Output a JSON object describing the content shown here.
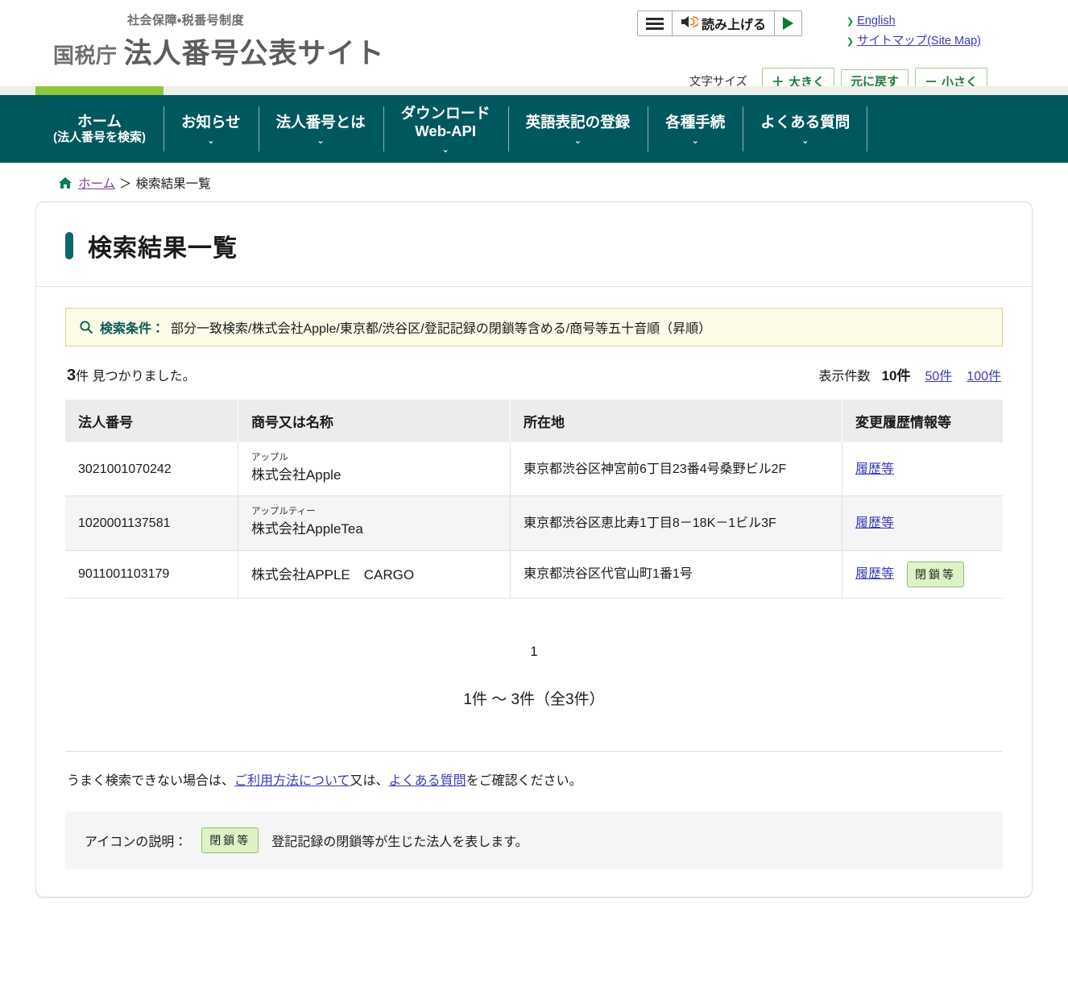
{
  "header": {
    "logo_sub": "社会保障・税番号制度",
    "logo_agency": "国税庁",
    "logo_title": "法人番号公表サイト",
    "speech": {
      "menu_icon": "hamburger-icon",
      "speaker_icon": "speaker-icon",
      "label": "読み上げる",
      "play_icon": "play-icon"
    },
    "corner_links": [
      {
        "label": "English"
      },
      {
        "label": "サイトマップ(Site Map)"
      }
    ],
    "fontsize": {
      "label": "文字サイズ",
      "bigger_sign": "＋",
      "bigger": "大きく",
      "reset": "元に戻す",
      "smaller_sign": "－",
      "smaller": "小さく"
    }
  },
  "nav": {
    "items": [
      {
        "label": "ホーム",
        "sub": "(法人番号を検索)",
        "caret": false,
        "active": true
      },
      {
        "label": "お知らせ",
        "sub": "",
        "caret": true,
        "active": false
      },
      {
        "label": "法人番号とは",
        "sub": "",
        "caret": true,
        "active": false
      },
      {
        "label": "ダウンロード",
        "sub": "Web-API",
        "caret": true,
        "active": false
      },
      {
        "label": "英語表記の登録",
        "sub": "",
        "caret": true,
        "active": false
      },
      {
        "label": "各種手続",
        "sub": "",
        "caret": true,
        "active": false
      },
      {
        "label": "よくある質問",
        "sub": "",
        "caret": true,
        "active": false
      }
    ]
  },
  "breadcrumb": {
    "home_icon": "home-icon",
    "home": "ホーム",
    "separator": "＞",
    "current": "検索結果一覧"
  },
  "page": {
    "title": "検索結果一覧"
  },
  "search_condition": {
    "icon": "search-icon",
    "label": "検索条件：",
    "value": "部分一致検索/株式会社Apple/東京都/渋谷区/登記記録の閉鎖等含める/商号等五十音順（昇順）"
  },
  "result_summary": {
    "count": "3",
    "count_suffix": "件 見つかりました。",
    "display_label": "表示件数",
    "current": "10件",
    "options": [
      "50件",
      "100件"
    ]
  },
  "table": {
    "columns": [
      "法人番号",
      "商号又は名称",
      "所在地",
      "変更履歴情報等"
    ],
    "rows": [
      {
        "number": "3021001070242",
        "kana": "アップル",
        "name": "株式会社Apple",
        "address": "東京都渋谷区神宮前6丁目23番4号桑野ビル2F",
        "history_link": "履歴等",
        "closed_badge": ""
      },
      {
        "number": "1020001137581",
        "kana": "アップルティー",
        "name": "株式会社AppleTea",
        "address": "東京都渋谷区恵比寿1丁目8－18K－1ビル3F",
        "history_link": "履歴等",
        "closed_badge": ""
      },
      {
        "number": "9011001103179",
        "kana": "",
        "name": "株式会社APPLE　CARGO",
        "address": "東京都渋谷区代官山町1番1号",
        "history_link": "履歴等",
        "closed_badge": "閉鎖等"
      }
    ]
  },
  "pagination": {
    "current_page": "1",
    "range_text": "1件 〜 3件（全3件）"
  },
  "help": {
    "prefix": "うまく検索できない場合は、",
    "link1": "ご利用方法について",
    "middle": "又は、",
    "link2": "よくある質問",
    "suffix": "をご確認ください。"
  },
  "icon_note": {
    "label": "アイコンの説明：",
    "badge": "閉鎖等",
    "description": "登記記録の閉鎖等が生じた法人を表します。"
  },
  "colors": {
    "nav_bg": "#00585f",
    "active_tab": "#8cc63e",
    "accent": "#046a68",
    "link": "#3b3bbd",
    "visited_link": "#7a3fa0",
    "condition_bg": "#fbfbe8",
    "badge_bg": "#ddf3c5",
    "badge_border": "#8cc26a"
  }
}
